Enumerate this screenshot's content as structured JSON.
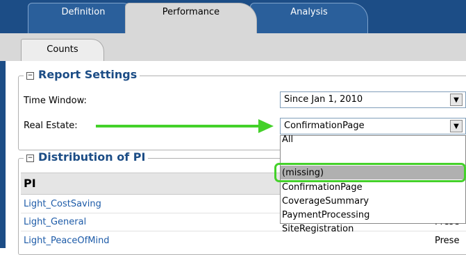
{
  "tabs": {
    "definition": "Definition",
    "performance": "Performance",
    "analysis": "Analysis"
  },
  "subtabs": {
    "counts": "Counts"
  },
  "report_settings": {
    "title": "Report Settings",
    "time_window_label": "Time Window:",
    "time_window_value": "Since Jan 1, 2010",
    "real_estate_label": "Real Estate:",
    "real_estate_value": "ConfirmationPage"
  },
  "distribution": {
    "title": "Distribution of PI",
    "column_header": "PI",
    "rows": [
      "Light_CostSaving",
      "Light_General",
      "Light_PeaceOfMind"
    ],
    "partial_values": [
      "Prese",
      "Prese"
    ]
  },
  "dropdown_options": [
    "All",
    "(missing)",
    "ConfirmationPage",
    "CoverageSummary",
    "PaymentProcessing",
    "SiteRegistration"
  ],
  "highlighted_option_index": 1,
  "colors": {
    "accent_blue": "#1c4d86",
    "highlight_green": "#44d12a",
    "link_blue": "#1d5ba8"
  },
  "icons": {
    "collapse": "minus-box-icon",
    "dropdown_arrow": "chevron-down-icon"
  }
}
